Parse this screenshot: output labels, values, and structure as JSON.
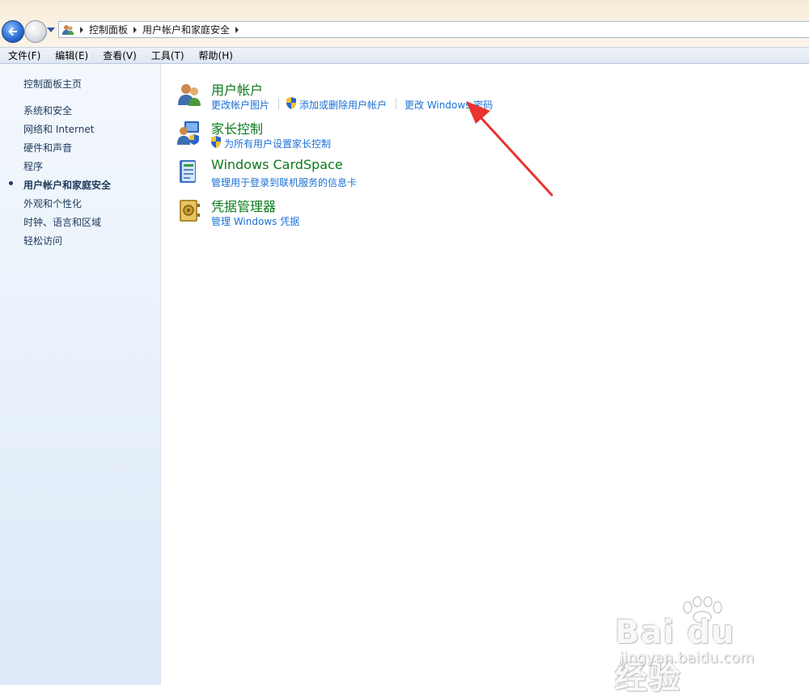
{
  "nav": {
    "back_icon": "back-arrow-icon",
    "forward_icon": "forward-arrow-icon",
    "history_icon": "dropdown-arrow-icon"
  },
  "address": {
    "icon": "user-accounts-icon",
    "crumbs": [
      "控制面板",
      "用户帐户和家庭安全"
    ]
  },
  "menubar": {
    "items": [
      "文件(F)",
      "编辑(E)",
      "查看(V)",
      "工具(T)",
      "帮助(H)"
    ]
  },
  "sidebar": {
    "home": "控制面板主页",
    "items": [
      {
        "label": "系统和安全",
        "current": false
      },
      {
        "label": "网络和 Internet",
        "current": false
      },
      {
        "label": "硬件和声音",
        "current": false
      },
      {
        "label": "程序",
        "current": false
      },
      {
        "label": "用户帐户和家庭安全",
        "current": true
      },
      {
        "label": "外观和个性化",
        "current": false
      },
      {
        "label": "时钟、语言和区域",
        "current": false
      },
      {
        "label": "轻松访问",
        "current": false
      }
    ]
  },
  "categories": [
    {
      "title": "用户帐户",
      "icon": "user-accounts-icon",
      "links": [
        "更改帐户图片",
        "添加或删除用户帐户",
        "更改 Windows 密码"
      ]
    },
    {
      "title": "家长控制",
      "icon": "parental-controls-icon",
      "links": [
        "为所有用户设置家长控制"
      ]
    },
    {
      "title": "Windows CardSpace",
      "icon": "cardspace-icon",
      "links": [
        "管理用于登录到联机服务的信息卡"
      ]
    },
    {
      "title": "凭据管理器",
      "icon": "credential-manager-icon",
      "links": [
        "管理 Windows 凭据"
      ]
    }
  ],
  "watermark": {
    "brand": "Bai du 经验",
    "url": "jingyan.baidu.com"
  },
  "colors": {
    "category_title": "#0a7a1c",
    "link": "#1a6fd6",
    "annotation": "#e8342d"
  }
}
